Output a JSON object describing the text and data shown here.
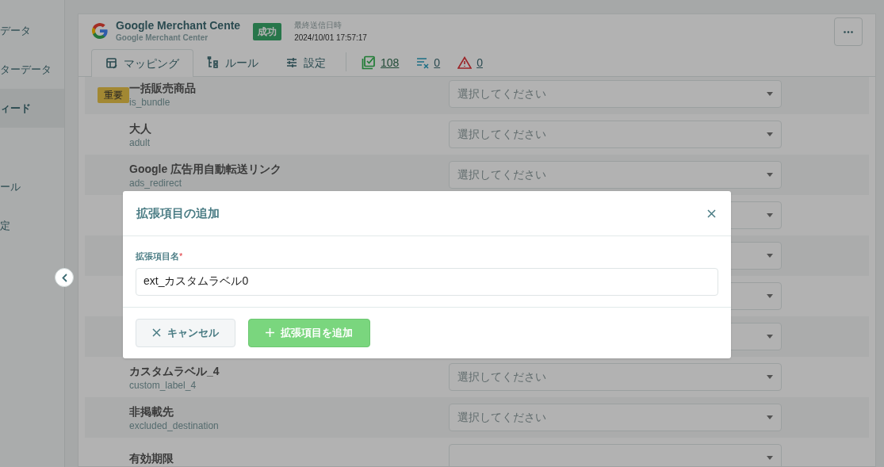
{
  "sidebar": {
    "items": [
      {
        "label": "データ",
        "selected": false
      },
      {
        "label": "ターデータ",
        "selected": false
      },
      {
        "label": "ィード",
        "selected": true
      },
      {
        "label": "ール",
        "selected": false
      },
      {
        "label": "定",
        "selected": false
      }
    ]
  },
  "channel": {
    "name": "Google Merchant Cente",
    "subtitle": "Google Merchant Center",
    "status": "成功",
    "last_sent_label": "最終送信日時",
    "last_sent": "2024/10/01 17:57:17"
  },
  "tabs": [
    {
      "label": "マッピング",
      "kind": "mapping",
      "selected": true
    },
    {
      "label": "ルール",
      "kind": "rules",
      "selected": false
    },
    {
      "label": "設定",
      "kind": "settings",
      "selected": false
    }
  ],
  "counts": [
    {
      "kind": "ok",
      "value": "108"
    },
    {
      "kind": "excluded",
      "value": "0"
    },
    {
      "kind": "warning",
      "value": "0"
    }
  ],
  "rows": [
    {
      "kind": "field",
      "badge": "重要",
      "label": "一括販売商品",
      "key": "is_bundle",
      "placeholder": "選択してください"
    },
    {
      "kind": "field",
      "label": "大人",
      "key": "adult",
      "placeholder": "選択してください"
    },
    {
      "kind": "field",
      "label": "Google 広告用自動転送リンク",
      "key": "ads_redirect",
      "placeholder": "選択してください"
    },
    {
      "kind": "covered"
    },
    {
      "kind": "covered"
    },
    {
      "kind": "covered"
    },
    {
      "kind": "covered"
    },
    {
      "kind": "field",
      "label": "カスタムラベル_4",
      "key": "custom_label_4",
      "placeholder": "選択してください"
    },
    {
      "kind": "field",
      "label": "非掲載先",
      "key": "excluded_destination",
      "placeholder": "選択してください"
    },
    {
      "kind": "field",
      "label": "有効期限"
    }
  ],
  "dialog": {
    "title": "拡張項目の追加",
    "field_label": "拡張項目名",
    "required": true,
    "required_mark": "*",
    "value": "ext_カスタムラベル0",
    "cancel": "キャンセル",
    "submit": "拡張項目を追加"
  }
}
